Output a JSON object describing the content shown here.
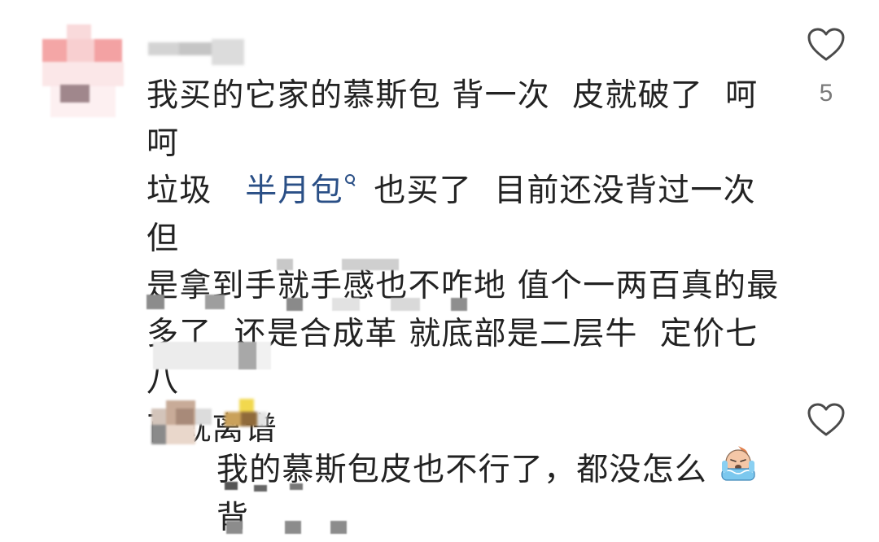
{
  "comments": [
    {
      "body_parts": {
        "p1": "我买的它家的慕斯包 背一次  皮就破了  呵呵\n垃圾   ",
        "link": "半月包",
        "p2": " 也买了  目前还没背过一次  但\n是拿到手就手感也不咋地 值个一两百真的最\n多了  还是合成革 就底部是二层牛  定价七八\n百就离谱"
      },
      "like_count": "5",
      "icons": {
        "like": "heart-outline-icon",
        "search": "search-icon"
      }
    },
    {
      "body": "我的慕斯包皮也不行了，都没怎么背",
      "emoji": "crying-face-emoji",
      "icons": {
        "like": "heart-outline-icon"
      }
    }
  ],
  "colors": {
    "link": "#2a4f86",
    "text": "#222222",
    "muted": "#7a7a7a",
    "background": "#ffffff"
  }
}
